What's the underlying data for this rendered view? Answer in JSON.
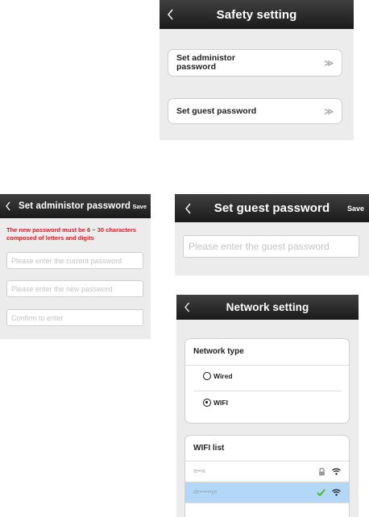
{
  "safety": {
    "title": "Safety setting",
    "items": [
      {
        "label": "Set administor\npassword",
        "chevron": "≫"
      },
      {
        "label": "Set guest password",
        "chevron": "≫"
      }
    ]
  },
  "admin": {
    "title": "Set administor password",
    "save": "Save",
    "note": "The new password must be 6 ~ 30 characters composed of letters and digits",
    "current_placeholder": "Please enter the current password",
    "new_placeholder": "Please enter the new password",
    "confirm_placeholder": "Confirm to enter"
  },
  "guest": {
    "title": "Set guest password",
    "save": "Save",
    "placeholder": "Please enter the guest password"
  },
  "network": {
    "title": "Network setting",
    "type_title": "Network type",
    "options": [
      {
        "label": "Wired",
        "selected": false
      },
      {
        "label": "WIFI",
        "selected": true
      }
    ],
    "wifi_title": "WIFI list",
    "wifi": [
      {
        "ssid": "te••a",
        "locked": true,
        "connected": false
      },
      {
        "ssid": "de••••••ye",
        "locked": false,
        "connected": true
      }
    ]
  },
  "colors": {
    "nav": "#1a1a1a",
    "background": "#ececec",
    "warning": "#e8151b",
    "selected_row": "#b3d7f7",
    "check": "#4cbb1f"
  },
  "icons": [
    "back-chevron-icon",
    "double-chevron-icon",
    "lock-icon",
    "wifi-signal-icon",
    "check-icon"
  ]
}
